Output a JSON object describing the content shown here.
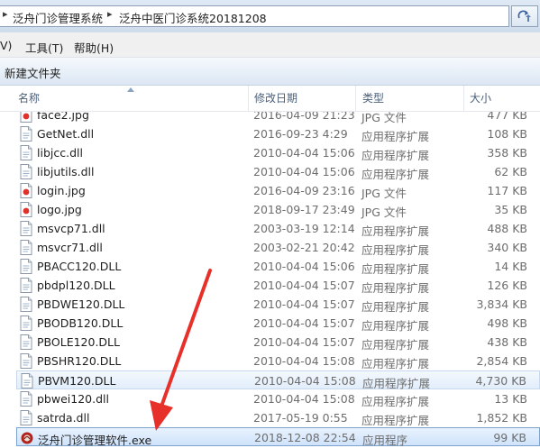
{
  "address": {
    "crumbs": [
      "泛舟门诊管理系统",
      "泛舟中医门诊系统20181208"
    ],
    "separator": "▸"
  },
  "menu": {
    "items": [
      "V)",
      "工具(T)",
      "帮助(H)"
    ]
  },
  "command_bar": {
    "new_folder": "新建文件夹"
  },
  "columns": {
    "name": "名称",
    "date": "修改日期",
    "type": "类型",
    "size": "大小"
  },
  "files": [
    {
      "name": "face2.jpg",
      "date": "2016-04-09 21:23",
      "type": "JPG 文件",
      "size": "477 KB",
      "icon": "image-icon",
      "partial": true
    },
    {
      "name": "GetNet.dll",
      "date": "2016-09-23 4:29",
      "type": "应用程序扩展",
      "size": "108 KB",
      "icon": "dll-icon"
    },
    {
      "name": "libjcc.dll",
      "date": "2010-04-04 15:06",
      "type": "应用程序扩展",
      "size": "358 KB",
      "icon": "dll-icon"
    },
    {
      "name": "libjutils.dll",
      "date": "2010-04-04 15:06",
      "type": "应用程序扩展",
      "size": "62 KB",
      "icon": "dll-icon"
    },
    {
      "name": "login.jpg",
      "date": "2016-04-09 23:16",
      "type": "JPG 文件",
      "size": "117 KB",
      "icon": "image-icon"
    },
    {
      "name": "logo.jpg",
      "date": "2018-09-17 23:49",
      "type": "JPG 文件",
      "size": "35 KB",
      "icon": "image-icon"
    },
    {
      "name": "msvcp71.dll",
      "date": "2003-03-19 12:14",
      "type": "应用程序扩展",
      "size": "488 KB",
      "icon": "dll-icon"
    },
    {
      "name": "msvcr71.dll",
      "date": "2003-02-21 20:42",
      "type": "应用程序扩展",
      "size": "340 KB",
      "icon": "dll-icon"
    },
    {
      "name": "PBACC120.DLL",
      "date": "2010-04-04 15:06",
      "type": "应用程序扩展",
      "size": "14 KB",
      "icon": "dll-icon"
    },
    {
      "name": "pbdpl120.DLL",
      "date": "2010-04-04 15:07",
      "type": "应用程序扩展",
      "size": "126 KB",
      "icon": "dll-icon"
    },
    {
      "name": "PBDWE120.DLL",
      "date": "2010-04-04 15:07",
      "type": "应用程序扩展",
      "size": "3,834 KB",
      "icon": "dll-icon"
    },
    {
      "name": "PBODB120.DLL",
      "date": "2010-04-04 15:07",
      "type": "应用程序扩展",
      "size": "498 KB",
      "icon": "dll-icon"
    },
    {
      "name": "PBOLE120.DLL",
      "date": "2010-04-04 15:07",
      "type": "应用程序扩展",
      "size": "438 KB",
      "icon": "dll-icon"
    },
    {
      "name": "PBSHR120.DLL",
      "date": "2010-04-04 15:08",
      "type": "应用程序扩展",
      "size": "2,854 KB",
      "icon": "dll-icon"
    },
    {
      "name": "PBVM120.DLL",
      "date": "2010-04-04 15:08",
      "type": "应用程序扩展",
      "size": "4,730 KB",
      "icon": "dll-icon",
      "state": "selected"
    },
    {
      "name": "pbwei120.dll",
      "date": "2010-04-04 15:08",
      "type": "应用程序扩展",
      "size": "13 KB",
      "icon": "dll-icon"
    },
    {
      "name": "satrda.dll",
      "date": "2017-05-19 0:55",
      "type": "应用程序扩展",
      "size": "1,852 KB",
      "icon": "dll-icon"
    },
    {
      "name": "泛舟门诊管理软件.exe",
      "date": "2018-12-08 22:54",
      "type": "应用程序",
      "size": "99 KB",
      "icon": "app-icon",
      "state": "highlighted"
    }
  ],
  "annotation": {
    "arrow_color": "#e8302a"
  }
}
